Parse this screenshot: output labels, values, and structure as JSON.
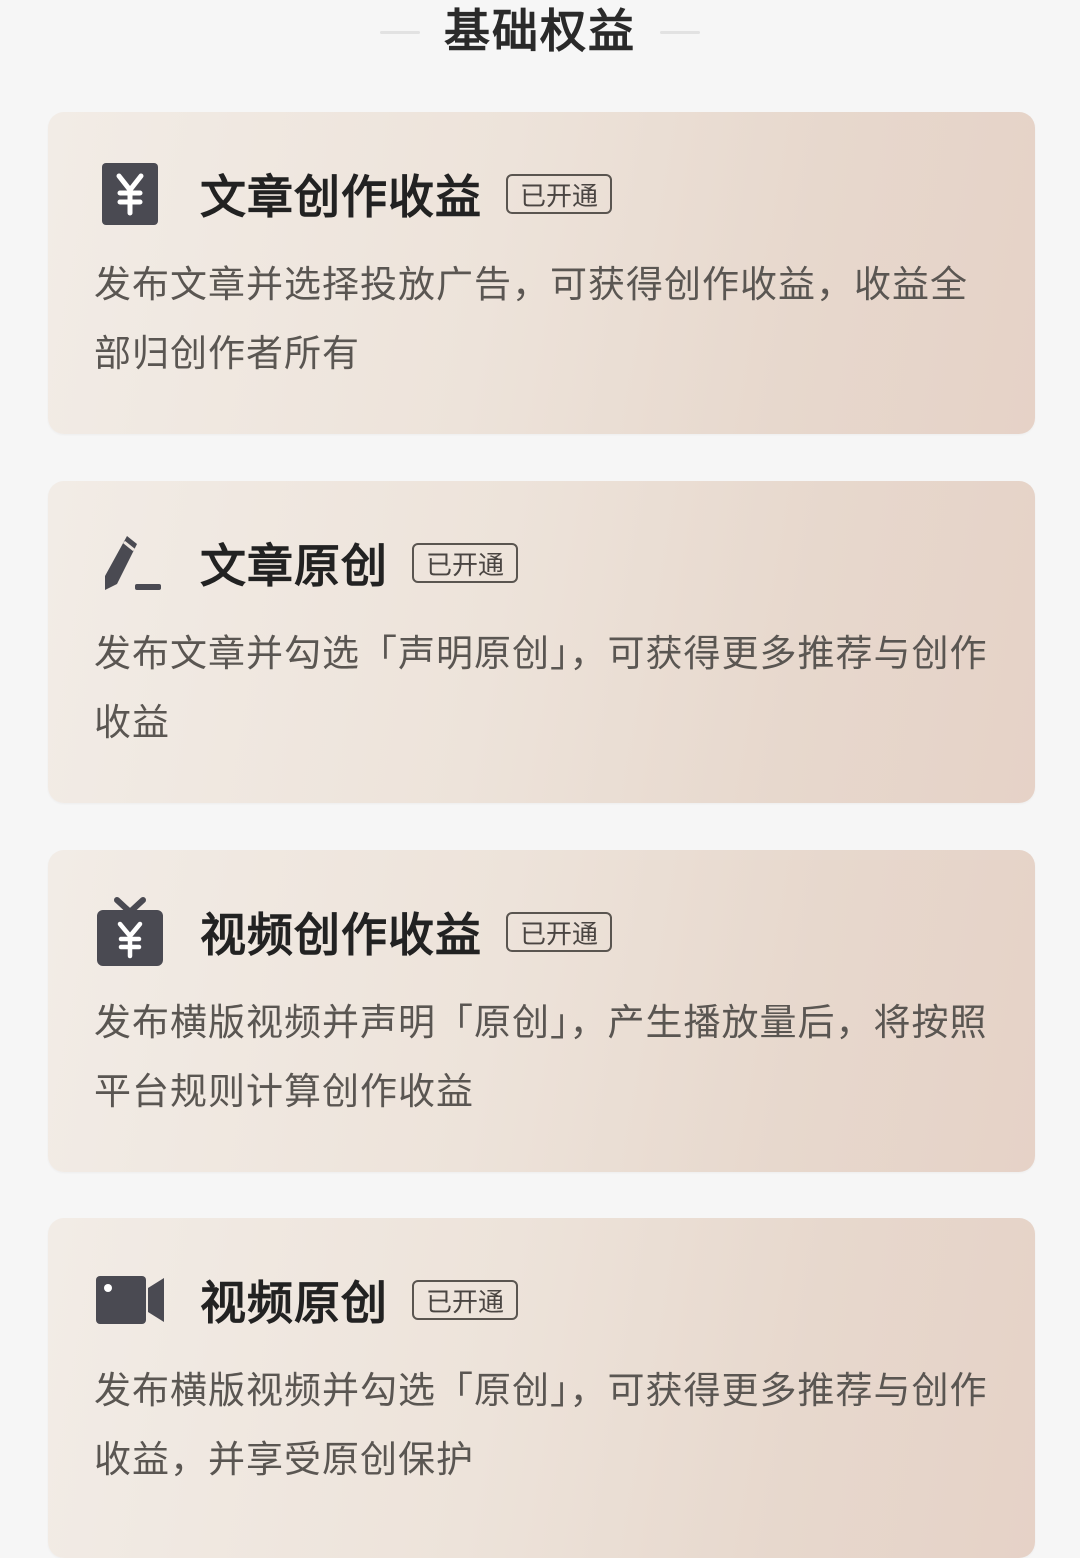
{
  "section": {
    "title": "基础权益"
  },
  "cards": [
    {
      "icon": "yuan-square-icon",
      "title": "文章创作收益",
      "badge": "已开通",
      "description": "发布文章并选择投放广告，可获得创作收益，收益全部归创作者所有"
    },
    {
      "icon": "pen-icon",
      "title": "文章原创",
      "badge": "已开通",
      "description": "发布文章并勾选「声明原创」，可获得更多推荐与创作收益"
    },
    {
      "icon": "tv-yuan-icon",
      "title": "视频创作收益",
      "badge": "已开通",
      "description": "发布横版视频并声明「原创」，产生播放量后，将按照平台规则计算创作收益"
    },
    {
      "icon": "video-camera-icon",
      "title": "视频原创",
      "badge": "已开通",
      "description": "发布横版视频并勾选「原创」，可获得更多推荐与创作收益，并享受原创保护"
    }
  ],
  "colors": {
    "icon": "#4a4a52",
    "title": "#222222",
    "description": "#5a5652",
    "page_background": "#f6f6f6"
  }
}
